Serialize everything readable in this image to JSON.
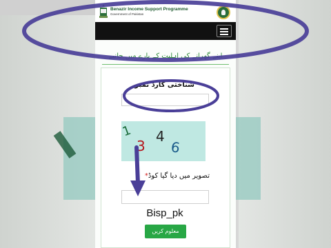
{
  "header": {
    "brand_title": "Benazir Income Support Programme",
    "brand_subtitle": "Government of Pakistan",
    "left_logo_icon": "pakistan-emblem-icon",
    "right_logo_icon": "bisp-seal-icon",
    "menu_icon": "hamburger-menu-icon"
  },
  "form": {
    "heading": "اپنے گھرانے کی اہلیت کے بارے میں جانیے",
    "id_label": "شناختی کارڈ نمبر",
    "id_value": "",
    "captcha_chars": [
      "1",
      "3",
      "4",
      "6"
    ],
    "code_label": "تصویر میں دیا گیا کوڈ",
    "required_mark": "*",
    "code_value": "",
    "submit_label": "معلوم کریں"
  },
  "overlay": {
    "caption": "Bisp_pk"
  },
  "colors": {
    "brand_green": "#1e5b2f",
    "heading_green": "#2e8b3a",
    "button_green": "#28a745",
    "captcha_bg": "#bfe8e2",
    "annotation_purple": "#4a3f98",
    "navbar": "#111111"
  }
}
